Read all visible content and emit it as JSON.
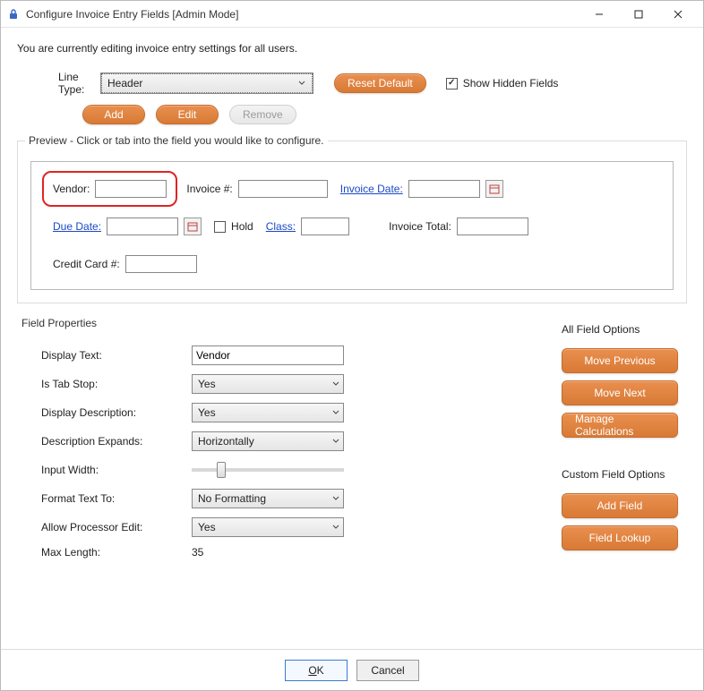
{
  "window": {
    "title": "Configure Invoice Entry Fields [Admin Mode]",
    "icon": "lock-icon"
  },
  "info_text": "You are currently editing invoice entry settings for all users.",
  "line_type": {
    "label": "Line Type:",
    "value": "Header"
  },
  "buttons": {
    "reset_default": "Reset Default",
    "show_hidden": "Show Hidden Fields",
    "show_hidden_checked": true,
    "add": "Add",
    "edit": "Edit",
    "remove": "Remove"
  },
  "preview": {
    "legend": "Preview - Click or tab into the field you would like to configure.",
    "fields": {
      "vendor_label": "Vendor:",
      "invoice_num_label": "Invoice #:",
      "invoice_date_label": "Invoice Date:",
      "due_date_label": "Due Date:",
      "hold_label": "Hold",
      "class_label": "Class:",
      "invoice_total_label": "Invoice Total:",
      "credit_card_label": "Credit Card #:"
    }
  },
  "field_props": {
    "legend": "Field Properties",
    "display_text_label": "Display Text:",
    "display_text_value": "Vendor",
    "is_tab_stop_label": "Is Tab Stop:",
    "is_tab_stop_value": "Yes",
    "display_desc_label": "Display Description:",
    "display_desc_value": "Yes",
    "desc_expands_label": "Description Expands:",
    "desc_expands_value": "Horizontally",
    "input_width_label": "Input Width:",
    "format_text_label": "Format Text To:",
    "format_text_value": "No Formatting",
    "allow_proc_label": "Allow Processor Edit:",
    "allow_proc_value": "Yes",
    "max_length_label": "Max Length:",
    "max_length_value": "35"
  },
  "all_field_options": {
    "legend": "All Field Options",
    "move_previous": "Move Previous",
    "move_next": "Move Next",
    "manage_calc": "Manage Calculations"
  },
  "custom_field_options": {
    "legend": "Custom Field Options",
    "add_field": "Add Field",
    "field_lookup": "Field Lookup"
  },
  "footer": {
    "ok": "OK",
    "cancel": "Cancel"
  }
}
